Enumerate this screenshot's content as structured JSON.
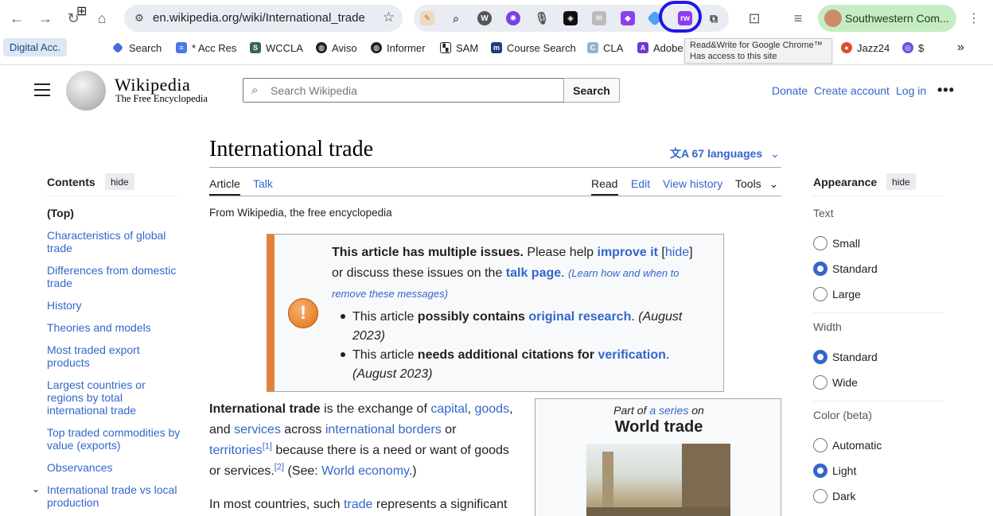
{
  "browser": {
    "url": "en.wikipedia.org/wiki/International_trade",
    "profile_name": "Southwestern Com...",
    "tooltip_line1": "Read&Write for Google Chrome™",
    "tooltip_line2": "Has access to this site",
    "digital_acc": "Digital Acc.",
    "bookmarks": [
      "Search",
      "* Acc Res",
      "WCCLA",
      "Aviso",
      "Informer",
      "SAM",
      "Course Search",
      "CLA",
      "Adobe",
      "Jazz24",
      "$"
    ],
    "overflow": "»"
  },
  "wiki": {
    "wordmark": "Wikipedia",
    "tagline": "The Free Encyclopedia",
    "search_placeholder": "Search Wikipedia",
    "search_button": "Search",
    "donate": "Donate",
    "create_account": "Create account",
    "log_in": "Log in",
    "more": "•••"
  },
  "toc": {
    "title": "Contents",
    "hide": "hide",
    "items": [
      "(Top)",
      "Characteristics of global trade",
      "Differences from domestic trade",
      "History",
      "Theories and models",
      "Most traded export products",
      "Largest countries or regions by total international trade",
      "Top traded commodities by value (exports)",
      "Observances",
      "International trade vs local production"
    ]
  },
  "article": {
    "title": "International trade",
    "languages": "67 languages",
    "tabs": {
      "article": "Article",
      "talk": "Talk",
      "read": "Read",
      "edit": "Edit",
      "history": "View history",
      "tools": "Tools"
    },
    "from": "From Wikipedia, the free encyclopedia",
    "issues": {
      "l1_bold": "This article has multiple issues.",
      "l1_text": " Please help ",
      "l1_link": "improve it",
      "l1_hide": "hide",
      "l2_text": "or discuss these issues on the ",
      "l2_link": "talk page",
      "l2_small": "(Learn how and when to",
      "l3_small": "remove these messages)",
      "b1_pre": "This article ",
      "b1_bold": "possibly contains",
      "b1_link": "original research",
      "b1_date1": "(August",
      "b1_date2": "2023)",
      "b2_pre": "This article ",
      "b2_bold": "needs additional citations for",
      "b2_link": "verification",
      "b2_date": "(August 2023)"
    },
    "para1": {
      "bold": "International trade",
      "t1": " is the exchange of ",
      "capital": "capital",
      "goods": "goods",
      "and": "and ",
      "services": "services",
      "across": " across ",
      "borders": "international borders",
      "or": " or",
      "territories": "territories",
      "ref1": "[1]",
      "because": " because there is a need or want of goods",
      "or_services": "or services.",
      "ref2": "[2]",
      "see": " (See: ",
      "world_economy": "World economy",
      "close": ".)"
    },
    "para2": {
      "t1": "In most countries, such ",
      "trade": "trade",
      "t2": " represents a significant"
    },
    "infobox": {
      "part_of": "Part of ",
      "a_series": "a series",
      "on": " on",
      "title": "World trade"
    }
  },
  "appearance": {
    "title": "Appearance",
    "hide": "hide",
    "text_label": "Text",
    "text_options": [
      "Small",
      "Standard",
      "Large"
    ],
    "text_selected": "Standard",
    "width_label": "Width",
    "width_options": [
      "Standard",
      "Wide"
    ],
    "width_selected": "Standard",
    "color_label": "Color (beta)",
    "color_options": [
      "Automatic",
      "Light",
      "Dark"
    ],
    "color_selected": "Light"
  }
}
